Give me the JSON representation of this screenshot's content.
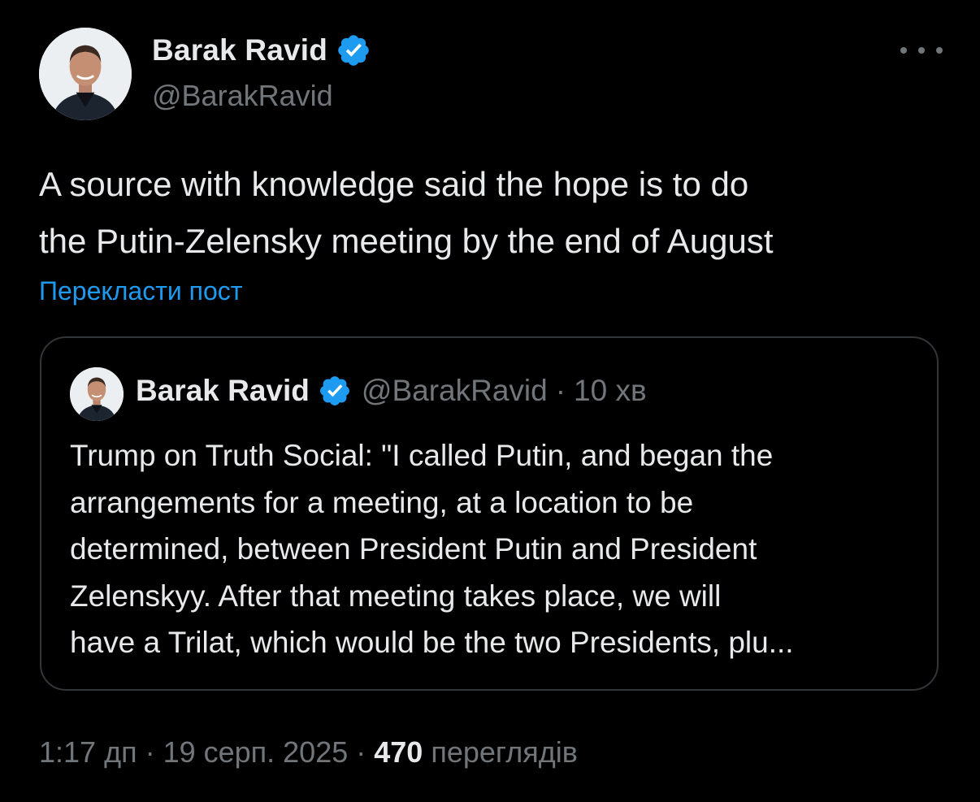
{
  "author": {
    "name": "Barak Ravid",
    "handle": "@BarakRavid",
    "verified_color": "#1d9bf0"
  },
  "post": {
    "text_line1": "A source with knowledge said the hope is to do",
    "text_line2": "the Putin-Zelensky meeting by the end of August",
    "translate_label": "Перекласти пост"
  },
  "quote": {
    "name": "Barak Ravid",
    "handle": "@BarakRavid",
    "separator": "·",
    "time": "10 хв",
    "lines": [
      "Trump on Truth Social: \"I called Putin, and began the",
      "arrangements for a meeting, at a location to be",
      "determined, between President Putin and President",
      "Zelenskyy. After that meeting takes place, we will",
      "have a Trilat, which would be the two Presidents, plu..."
    ]
  },
  "footer": {
    "time": "1:17 дп",
    "separator": "·",
    "date": "19 серп. 2025",
    "views_count": "470",
    "views_label": "переглядів"
  },
  "icons": {
    "more": "more-dots-icon",
    "verified": "verified-badge-icon"
  }
}
